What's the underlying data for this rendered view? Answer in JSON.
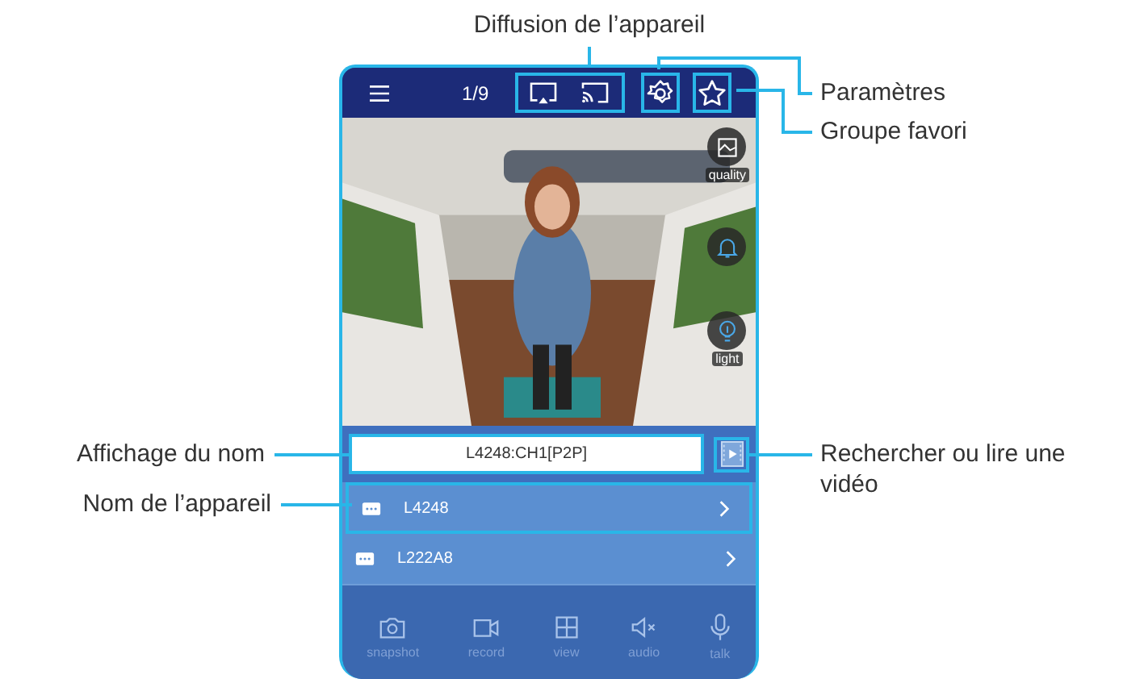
{
  "annotations": [
    {
      "text": "Diffusion de l’appareil"
    },
    {
      "text": "Paramètres"
    },
    {
      "text": "Groupe favori"
    },
    {
      "text": "Affichage du nom"
    },
    {
      "text": "Nom de l’appareil"
    },
    {
      "text": "Rechercher ou lire une vidéo"
    }
  ],
  "top_bar": {
    "counter": "1/9"
  },
  "overlay_buttons": [
    {
      "kind": "quality",
      "label": "quality"
    },
    {
      "kind": "bell"
    },
    {
      "kind": "light",
      "label": "light"
    }
  ],
  "name_field": {
    "value": "L4248:CH1[P2P]"
  },
  "devices": [
    {
      "name": "L4248"
    },
    {
      "name": "L222A8"
    }
  ],
  "toolbar": [
    {
      "kind": "snapshot",
      "label": "snapshot"
    },
    {
      "kind": "record",
      "label": "record"
    },
    {
      "kind": "view",
      "label": "view"
    },
    {
      "kind": "audio",
      "label": "audio"
    },
    {
      "kind": "talk",
      "label": "talk"
    }
  ]
}
